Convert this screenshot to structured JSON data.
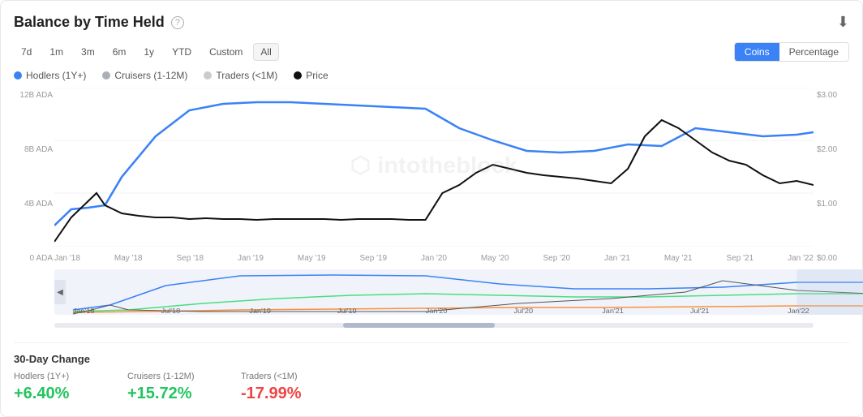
{
  "card": {
    "title": "Balance by Time Held",
    "help_tooltip": "?",
    "download_icon": "⬇"
  },
  "time_buttons": [
    {
      "label": "7d",
      "active": false
    },
    {
      "label": "1m",
      "active": false
    },
    {
      "label": "3m",
      "active": false
    },
    {
      "label": "6m",
      "active": false
    },
    {
      "label": "1y",
      "active": false
    },
    {
      "label": "YTD",
      "active": false
    },
    {
      "label": "Custom",
      "active": false
    },
    {
      "label": "All",
      "active": true
    }
  ],
  "view_toggle": {
    "coins_label": "Coins",
    "percentage_label": "Percentage",
    "active": "Coins"
  },
  "legend": [
    {
      "label": "Hodlers (1Y+)",
      "color": "#3b82f6"
    },
    {
      "label": "Cruisers (1-12M)",
      "color": "#aab0b8"
    },
    {
      "label": "Traders (<1M)",
      "color": "#c8ccd0"
    },
    {
      "label": "Price",
      "color": "#111"
    }
  ],
  "y_axis_left": [
    "12B ADA",
    "8B ADA",
    "4B ADA",
    "0 ADA"
  ],
  "y_axis_right": [
    "$3.00",
    "$2.00",
    "$1.00",
    "$0.00"
  ],
  "x_axis": [
    "Jan '18",
    "May '18",
    "Sep '18",
    "Jan '19",
    "May '19",
    "Sep '19",
    "Jan '20",
    "May '20",
    "Sep '20",
    "Jan '21",
    "May '21",
    "Sep '21",
    "Jan '22"
  ],
  "mini_x_axis": [
    "Jan'18",
    "Jul'18",
    "Jan'19",
    "Jul'19",
    "Jan'20",
    "Jul'20",
    "Jan'21",
    "Jul'21",
    "Jan'22"
  ],
  "watermark": "⬡ intotheblock",
  "change": {
    "title": "30-Day Change",
    "items": [
      {
        "header": "Hodlers (1Y+)",
        "value": "+6.40%",
        "positive": true
      },
      {
        "header": "Cruisers (1-12M)",
        "value": "+15.72%",
        "positive": true
      },
      {
        "header": "Traders (<1M)",
        "value": "-17.99%",
        "positive": false
      }
    ]
  },
  "scroll_arrow_left": "◀",
  "scroll_arrow_right": "▶"
}
